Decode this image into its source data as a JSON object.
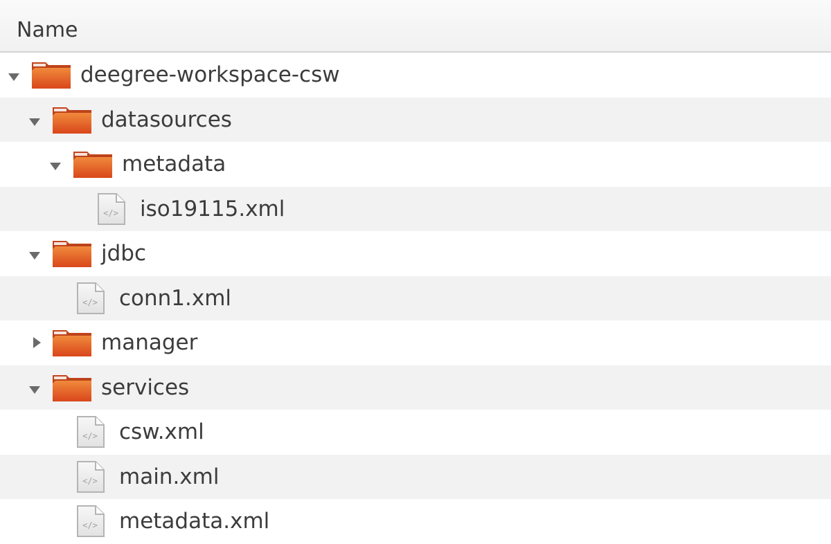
{
  "header": {
    "column_name": "Name"
  },
  "colors": {
    "folder": "#dd4814",
    "row_alt": "#f2f2f2"
  },
  "tree": [
    {
      "name": "deegree-workspace-csw",
      "type": "folder",
      "expander": "open"
    },
    {
      "name": "datasources",
      "type": "folder",
      "expander": "open"
    },
    {
      "name": "metadata",
      "type": "folder",
      "expander": "open"
    },
    {
      "name": "iso19115.xml",
      "type": "file",
      "icon": "xml-file-icon"
    },
    {
      "name": "jdbc",
      "type": "folder",
      "expander": "open"
    },
    {
      "name": "conn1.xml",
      "type": "file",
      "icon": "xml-file-icon"
    },
    {
      "name": "manager",
      "type": "folder",
      "expander": "closed"
    },
    {
      "name": "services",
      "type": "folder",
      "expander": "open"
    },
    {
      "name": "csw.xml",
      "type": "file",
      "icon": "xml-file-icon"
    },
    {
      "name": "main.xml",
      "type": "file",
      "icon": "xml-file-icon"
    },
    {
      "name": "metadata.xml",
      "type": "file",
      "icon": "xml-file-icon"
    }
  ]
}
